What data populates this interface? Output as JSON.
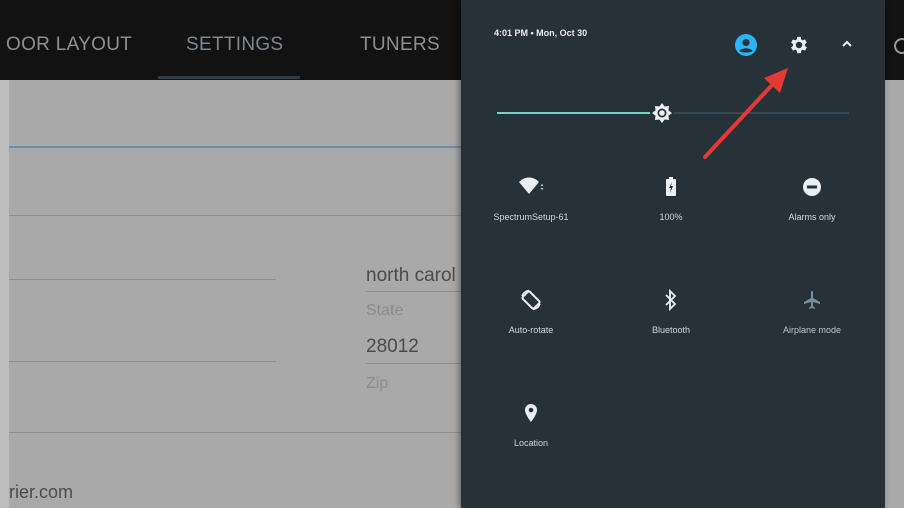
{
  "app": {
    "tabs": [
      {
        "label": "OOR LAYOUT"
      },
      {
        "label": "SETTINGS"
      },
      {
        "label": "TUNERS"
      }
    ],
    "fields": {
      "state_value": "north carol",
      "state_label": "State",
      "zip_value": "28012",
      "zip_label": "Zip",
      "email_fragment": "rier.com"
    }
  },
  "quick_settings": {
    "status_time": "4:01 PM  •  Mon, Oct 30",
    "brightness": 0.47,
    "accent_color": "#80cbc4",
    "user_icon_color": "#29b6f6",
    "tiles": [
      {
        "label": "SpectrumSetup-61",
        "icon": "wifi-icon"
      },
      {
        "label": "100%",
        "icon": "battery-icon"
      },
      {
        "label": "Alarms only",
        "icon": "do-not-disturb-icon"
      },
      {
        "label": "Auto-rotate",
        "icon": "auto-rotate-icon"
      },
      {
        "label": "Bluetooth",
        "icon": "bluetooth-icon"
      },
      {
        "label": "Airplane mode",
        "icon": "airplane-icon"
      },
      {
        "label": "Location",
        "icon": "location-icon"
      }
    ]
  }
}
